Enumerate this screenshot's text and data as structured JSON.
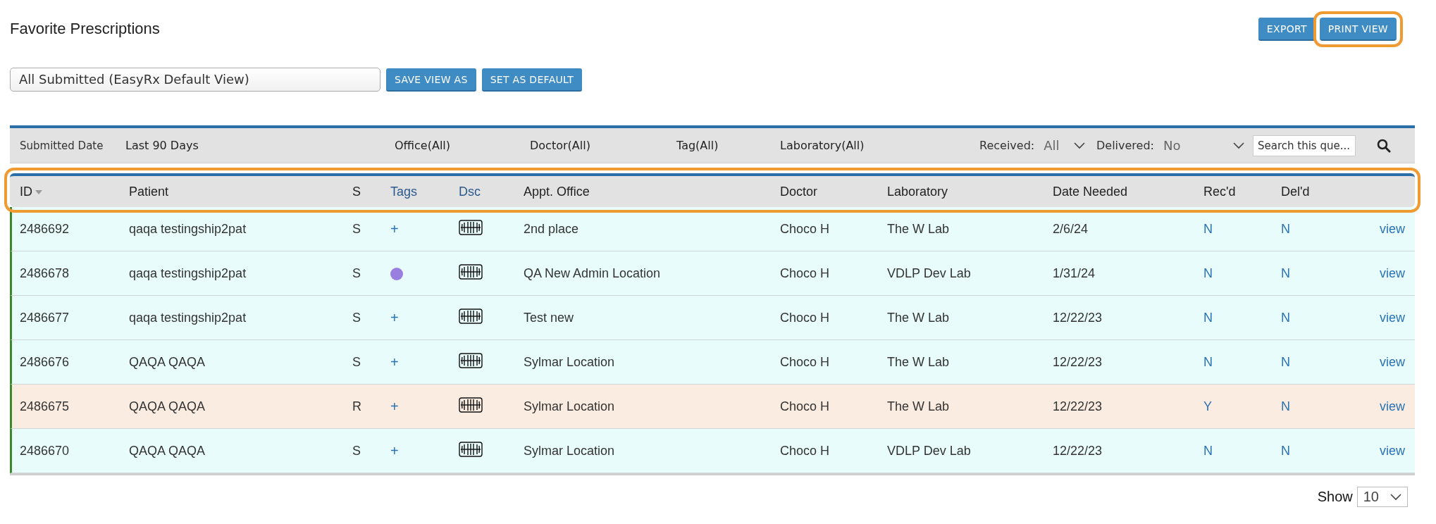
{
  "page_title": "Favorite Prescriptions",
  "actions": [
    {
      "label": "EXPORT",
      "highlighted": false
    },
    {
      "label": "PRINT VIEW",
      "highlighted": true
    }
  ],
  "view_select": {
    "value": "All Submitted (EasyRx Default View)"
  },
  "view_buttons": [
    "SAVE VIEW AS",
    "SET AS DEFAULT"
  ],
  "filters": {
    "date_label": "Submitted Date",
    "date_value": "Last 90 Days",
    "office": "Office(All)",
    "doctor": "Doctor(All)",
    "tag": "Tag(All)",
    "laboratory": "Laboratory(All)",
    "received_label": "Received:",
    "received_value": "All",
    "delivered_label": "Delivered:",
    "delivered_value": "No",
    "search": {
      "placeholder": "Search this que..."
    }
  },
  "table": {
    "highlighted": true,
    "columns": [
      {
        "label": "ID",
        "kind": "sortable"
      },
      {
        "label": "Patient",
        "kind": "plain"
      },
      {
        "label": "S",
        "kind": "plain"
      },
      {
        "label": "Tags",
        "kind": "link"
      },
      {
        "label": "Dsc",
        "kind": "link"
      },
      {
        "label": "Appt. Office",
        "kind": "plain"
      },
      {
        "label": "Doctor",
        "kind": "plain"
      },
      {
        "label": "Laboratory",
        "kind": "plain"
      },
      {
        "label": "Date Needed",
        "kind": "plain"
      },
      {
        "label": "Rec'd",
        "kind": "plain"
      },
      {
        "label": "Del'd",
        "kind": "plain"
      }
    ],
    "rows": [
      {
        "id": "2486692",
        "patient": "qaqa testingship2pat",
        "s": "S",
        "tag": {
          "kind": "add",
          "text": "+"
        },
        "office": "2nd place",
        "doctor": "Choco H",
        "laboratory": "The W Lab",
        "date_needed": "2/6/24",
        "recd": "N",
        "deld": "N",
        "action": "view",
        "flagged": false
      },
      {
        "id": "2486678",
        "patient": "qaqa testingship2pat",
        "s": "S",
        "tag": {
          "kind": "dot",
          "color": "#9a7ee0"
        },
        "office": "QA New Admin Location",
        "doctor": "Choco H",
        "laboratory": "VDLP Dev Lab",
        "date_needed": "1/31/24",
        "recd": "N",
        "deld": "N",
        "action": "view",
        "flagged": false
      },
      {
        "id": "2486677",
        "patient": "qaqa testingship2pat",
        "s": "S",
        "tag": {
          "kind": "add",
          "text": "+"
        },
        "office": "Test new",
        "doctor": "Choco H",
        "laboratory": "The W Lab",
        "date_needed": "12/22/23",
        "recd": "N",
        "deld": "N",
        "action": "view",
        "flagged": false
      },
      {
        "id": "2486676",
        "patient": "QAQA QAQA",
        "s": "S",
        "tag": {
          "kind": "add",
          "text": "+"
        },
        "office": "Sylmar Location",
        "doctor": "Choco H",
        "laboratory": "The W Lab",
        "date_needed": "12/22/23",
        "recd": "N",
        "deld": "N",
        "action": "view",
        "flagged": false
      },
      {
        "id": "2486675",
        "patient": "QAQA QAQA",
        "s": "R",
        "tag": {
          "kind": "add",
          "text": "+"
        },
        "office": "Sylmar Location",
        "doctor": "Choco H",
        "laboratory": "The W Lab",
        "date_needed": "12/22/23",
        "recd": "Y",
        "deld": "N",
        "action": "view",
        "flagged": true
      },
      {
        "id": "2486670",
        "patient": "QAQA QAQA",
        "s": "S",
        "tag": {
          "kind": "add",
          "text": "+"
        },
        "office": "Sylmar Location",
        "doctor": "Choco H",
        "laboratory": "VDLP Dev Lab",
        "date_needed": "12/22/23",
        "recd": "N",
        "deld": "N",
        "action": "view",
        "flagged": false
      }
    ]
  },
  "pager": {
    "label": "Show",
    "value": "10"
  }
}
